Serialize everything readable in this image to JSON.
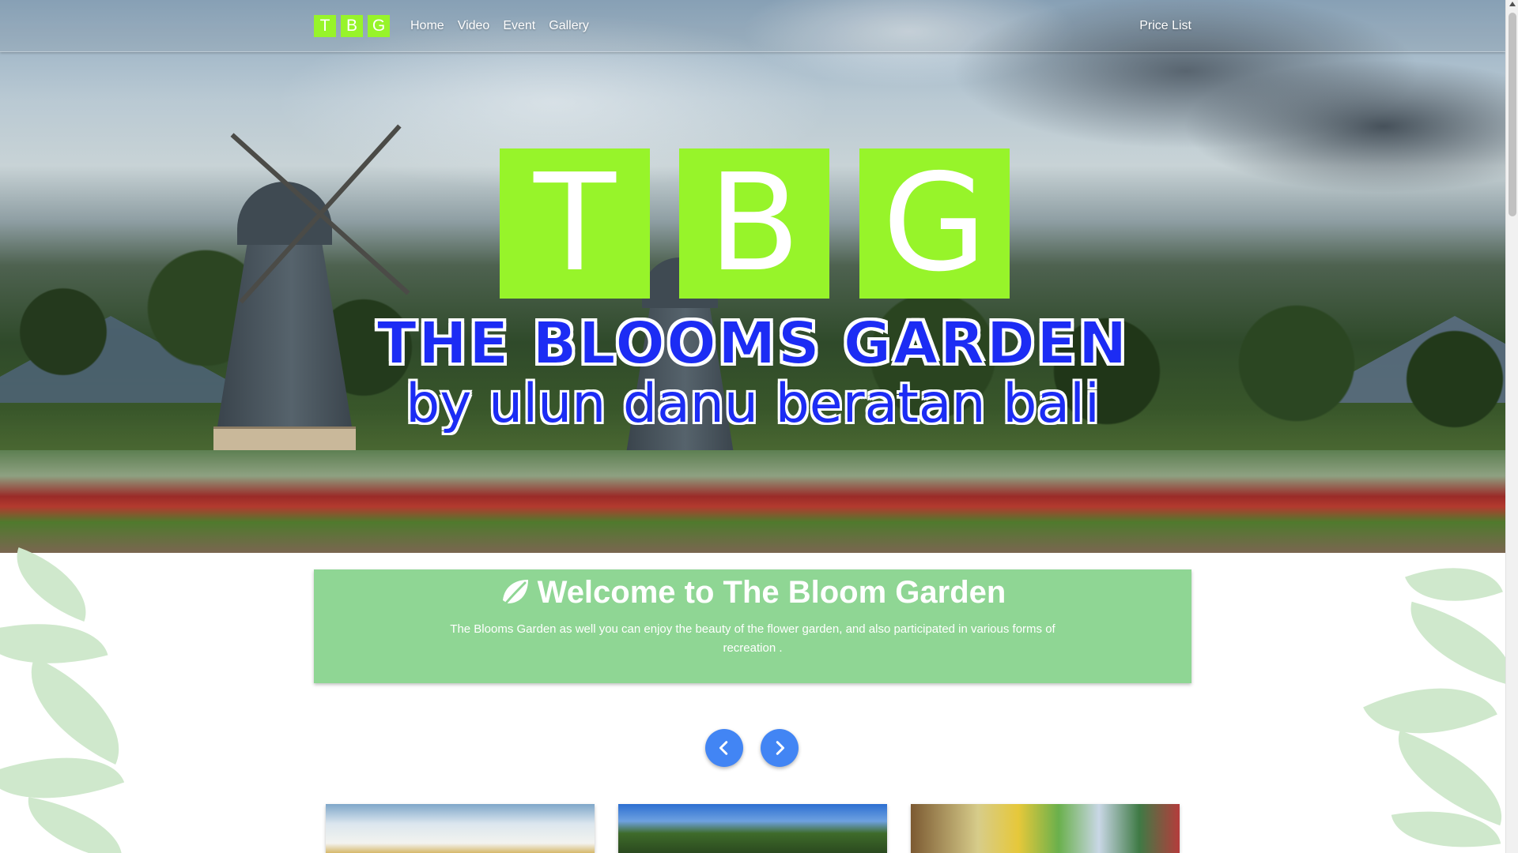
{
  "navbar": {
    "brand_letters": [
      "T",
      "B",
      "G"
    ],
    "links": [
      {
        "label": "Home"
      },
      {
        "label": "Video"
      },
      {
        "label": "Event"
      },
      {
        "label": "Gallery"
      }
    ],
    "right_link": "Price List"
  },
  "hero": {
    "logo_letters": [
      "T",
      "B",
      "G"
    ],
    "title": "THE BLOOMS GARDEN",
    "subtitle": "by ulun danu beratan bali"
  },
  "welcome": {
    "icon": "leaf-icon",
    "title": "Welcome to The Bloom Garden",
    "description": "The Blooms Garden as well you can enjoy the beauty of the flower garden, and also participated in various forms of recreation ."
  },
  "carousel": {
    "prev_icon": "chevron-left-icon",
    "next_icon": "chevron-right-icon"
  },
  "colors": {
    "brand_green": "#97f42a",
    "welcome_green": "#8fd694",
    "title_blue": "#1c2cf4",
    "button_blue": "#4285f4",
    "leaf_deco": "#cfe8cc"
  }
}
